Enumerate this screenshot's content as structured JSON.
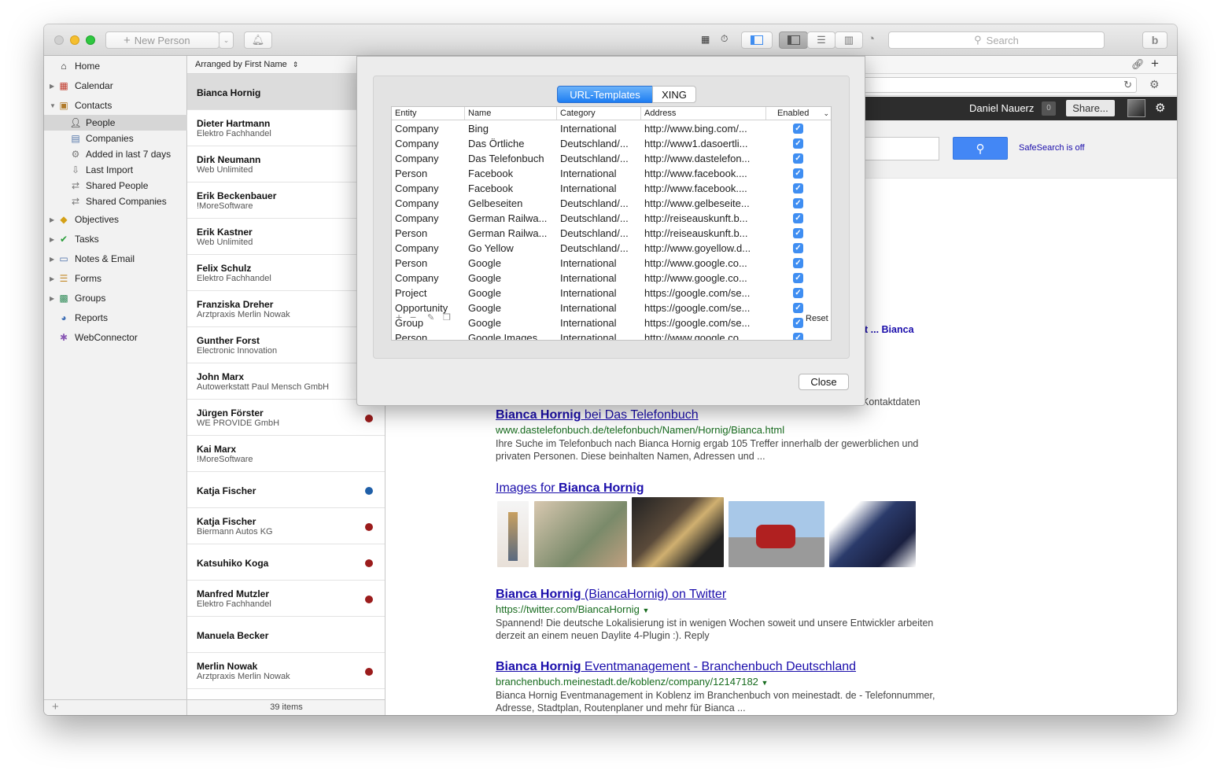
{
  "toolbar": {
    "new_person": "New Person",
    "search_placeholder": "Search"
  },
  "sidebar": {
    "home": "Home",
    "calendar": "Calendar",
    "contacts": "Contacts",
    "people": "People",
    "companies": "Companies",
    "added_last_7": "Added in last 7 days",
    "last_import": "Last Import",
    "shared_people": "Shared People",
    "shared_companies": "Shared Companies",
    "objectives": "Objectives",
    "tasks": "Tasks",
    "notes_email": "Notes & Email",
    "forms": "Forms",
    "groups": "Groups",
    "reports": "Reports",
    "webconnector": "WebConnector"
  },
  "list": {
    "arranged_by": "Arranged by First Name",
    "footer": "39 items",
    "people": [
      {
        "name": "Bianca Hornig",
        "company": "",
        "dot": ""
      },
      {
        "name": "Dieter Hartmann",
        "company": "Elektro Fachhandel",
        "dot": ""
      },
      {
        "name": "Dirk Neumann",
        "company": "Web Unlimited",
        "dot": ""
      },
      {
        "name": "Erik Beckenbauer",
        "company": "!MoreSoftware",
        "dot": ""
      },
      {
        "name": "Erik Kastner",
        "company": "Web Unlimited",
        "dot": ""
      },
      {
        "name": "Felix Schulz",
        "company": "Elektro Fachhandel",
        "dot": ""
      },
      {
        "name": "Franziska Dreher",
        "company": "Arztpraxis Merlin Nowak",
        "dot": ""
      },
      {
        "name": "Gunther Forst",
        "company": "Electronic Innovation",
        "dot": ""
      },
      {
        "name": "John Marx",
        "company": "Autowerkstatt Paul Mensch GmbH",
        "dot": ""
      },
      {
        "name": "Jürgen Förster",
        "company": "WE PROVIDE GmbH",
        "dot": "red"
      },
      {
        "name": "Kai Marx",
        "company": "!MoreSoftware",
        "dot": ""
      },
      {
        "name": "Katja Fischer",
        "company": "",
        "dot": "blue"
      },
      {
        "name": "Katja Fischer",
        "company": "Biermann Autos KG",
        "dot": "red"
      },
      {
        "name": "Katsuhiko Koga",
        "company": "",
        "dot": "red"
      },
      {
        "name": "Manfred Mutzler",
        "company": "Elektro Fachhandel",
        "dot": "red"
      },
      {
        "name": "Manuela Becker",
        "company": "",
        "dot": ""
      },
      {
        "name": "Merlin Nowak",
        "company": "Arztpraxis Merlin Nowak",
        "dot": "red"
      }
    ]
  },
  "detail": {
    "user": "Daniel Nauerz",
    "count_badge": "0",
    "share": "Share...",
    "safesearch": "SafeSearch is off",
    "peek1": "t ... Bianca",
    "peek2": "Kontaktdaten",
    "results": [
      {
        "title_bold": "Bianca Hornig",
        "title_rest": " bei Das Telefonbuch",
        "url": "www.dastelefonbuch.de/telefonbuch/Namen/Hornig/Bianca.html",
        "snippet": "Ihre Suche im Telefonbuch nach Bianca Hornig ergab 105 Treffer innerhalb der gewerblichen und privaten Personen. Diese beinhalten Namen, Adressen und ..."
      },
      {
        "title_bold": "Bianca Hornig",
        "title_rest": " (BiancaHornig) on Twitter",
        "url": "https://twitter.com/BiancaHornig",
        "snippet": "Spannend! Die deutsche Lokalisierung ist in wenigen Wochen soweit und unsere Entwickler arbeiten derzeit an einem neuen Daylite 4-Plugin :). Reply"
      },
      {
        "title_bold": "Bianca Hornig",
        "title_rest": " Eventmanagement - Branchenbuch Deutschland",
        "url": "branchenbuch.meinestadt.de/koblenz/company/12147182",
        "snippet": "Bianca Hornig Eventmanagement in Koblenz im Branchenbuch von meinestadt. de - Telefonnummer, Adresse, Stadtplan, Routenplaner und mehr für Bianca ..."
      }
    ],
    "images_heading_pre": "Images for ",
    "images_heading_bold": "Bianca Hornig"
  },
  "dialog": {
    "tab_url": "URL-Templates",
    "tab_xing": "XING",
    "columns": [
      "Entity",
      "Name",
      "Category",
      "Address",
      "Enabled"
    ],
    "rows": [
      [
        "Company",
        "Bing",
        "International",
        "http://www.bing.com/..."
      ],
      [
        "Company",
        "Das Örtliche",
        "Deutschland/...",
        "http://www1.dasoertli..."
      ],
      [
        "Company",
        "Das Telefonbuch",
        "Deutschland/...",
        "http://www.dastelefon..."
      ],
      [
        "Person",
        "Facebook",
        "International",
        "http://www.facebook...."
      ],
      [
        "Company",
        "Facebook",
        "International",
        "http://www.facebook...."
      ],
      [
        "Company",
        "Gelbeseiten",
        "Deutschland/...",
        "http://www.gelbeseite..."
      ],
      [
        "Company",
        "German Railwa...",
        "Deutschland/...",
        "http://reiseauskunft.b..."
      ],
      [
        "Person",
        "German Railwa...",
        "Deutschland/...",
        "http://reiseauskunft.b..."
      ],
      [
        "Company",
        "Go Yellow",
        "Deutschland/...",
        "http://www.goyellow.d..."
      ],
      [
        "Person",
        "Google",
        "International",
        "http://www.google.co..."
      ],
      [
        "Company",
        "Google",
        "International",
        "http://www.google.co..."
      ],
      [
        "Project",
        "Google",
        "International",
        "https://google.com/se..."
      ],
      [
        "Opportunity",
        "Google",
        "International",
        "https://google.com/se..."
      ],
      [
        "Group",
        "Google",
        "International",
        "https://google.com/se..."
      ],
      [
        "Person",
        "Google Images",
        "International",
        "http://www.google.co..."
      ]
    ],
    "reset": "Reset",
    "close": "Close"
  },
  "colors": {
    "accent": "#1d7df2",
    "link": "#1a0dab",
    "url_green": "#176b1e",
    "dot_red": "#9b1c1c",
    "dot_blue": "#1f5fa8"
  }
}
